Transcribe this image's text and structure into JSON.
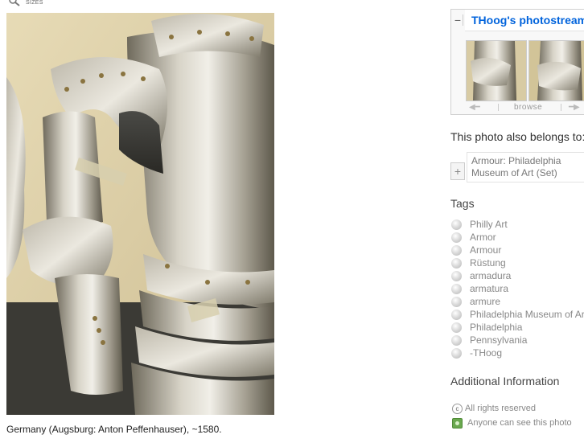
{
  "sizes_hint": {
    "label": "SIZES",
    "icon": "magnifier-icon"
  },
  "photo": {
    "caption": "Germany (Augsburg: Anton Peffenhauser), ~1580."
  },
  "photostream": {
    "title": "THoog's photostream",
    "toggle": "−",
    "browse_label": "browse",
    "prev_icon": "arrow-left-icon",
    "next_icon": "arrow-right-icon"
  },
  "sets": {
    "heading": "This photo also belongs to:",
    "add_icon": "+",
    "items": [
      {
        "label": "Armour: Philadelphia Museum of Art (Set)"
      }
    ]
  },
  "tags": {
    "heading": "Tags",
    "items": [
      "Philly Art",
      "Armor",
      "Armour",
      "Rüstung",
      "armadura",
      "armatura",
      "armure",
      "Philadelphia Museum of Art",
      "Philadelphia",
      "Pennsylvania",
      "-THoog"
    ]
  },
  "additional_info": {
    "heading": "Additional Information",
    "rights": "All rights reserved",
    "visibility": "Anyone can see this photo"
  },
  "colors": {
    "link_blue": "#0063dc",
    "tag_grey": "#888888",
    "public_green": "#6aa84f"
  }
}
